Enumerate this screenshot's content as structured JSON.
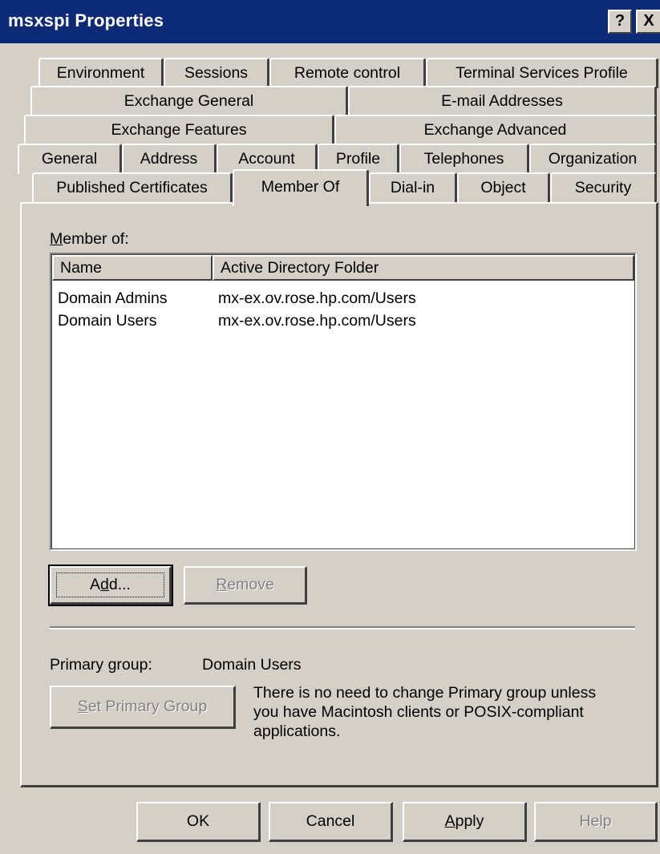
{
  "window": {
    "title": "msxspi Properties",
    "help_glyph": "?",
    "close_glyph": "X"
  },
  "tabs": {
    "row1": [
      "Environment",
      "Sessions",
      "Remote control",
      "Terminal Services Profile"
    ],
    "row2": [
      "Exchange General",
      "E-mail Addresses"
    ],
    "row3": [
      "Exchange Features",
      "Exchange Advanced"
    ],
    "row4": [
      "General",
      "Address",
      "Account",
      "Profile",
      "Telephones",
      "Organization"
    ],
    "row5": [
      "Published Certificates",
      "Member Of",
      "Dial-in",
      "Object",
      "Security"
    ],
    "active": "Member Of"
  },
  "member_of": {
    "label_prefix": "M",
    "label_rest": "ember of:",
    "columns": [
      "Name",
      "Active Directory Folder"
    ],
    "rows": [
      {
        "name": "Domain Admins",
        "folder": "mx-ex.ov.rose.hp.com/Users"
      },
      {
        "name": "Domain Users",
        "folder": "mx-ex.ov.rose.hp.com/Users"
      }
    ]
  },
  "buttons": {
    "add_pre": "A",
    "add_u": "d",
    "add_post": "d...",
    "remove_u": "R",
    "remove_rest": "emove",
    "set_primary_u": "S",
    "set_primary_rest": "et Primary Group",
    "ok": "OK",
    "cancel": "Cancel",
    "apply_u": "A",
    "apply_rest": "pply",
    "help": "Help"
  },
  "primary_group": {
    "label": "Primary group:",
    "value": "Domain Users",
    "note_line1": "There is no need to change Primary group unless",
    "note_line2": "you have Macintosh clients or POSIX-compliant",
    "note_line3": "applications."
  }
}
